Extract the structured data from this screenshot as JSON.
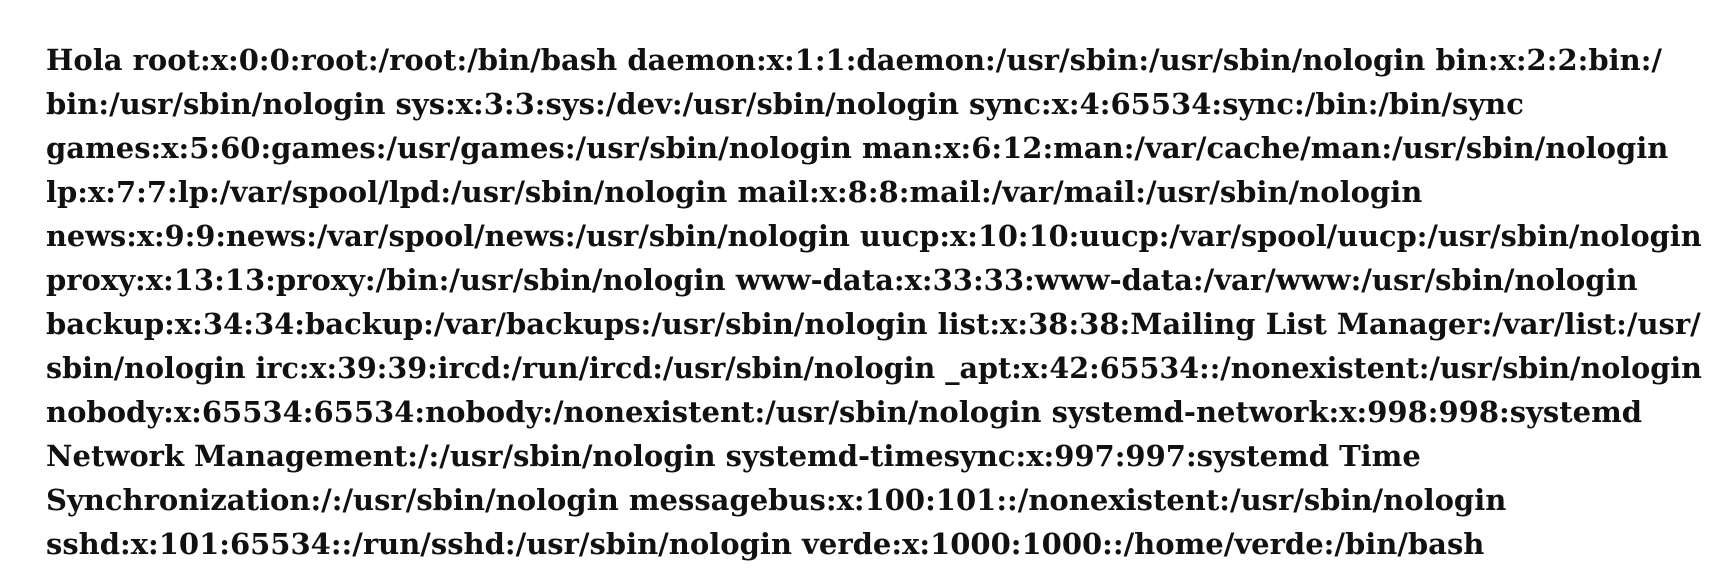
{
  "output": {
    "lines": [
      "Hola root:x:0:0:root:/root:/bin/bash daemon:x:1:1:daemon:/usr/sbin:/usr/sbin/nologin bin:x:2:2:bin:/",
      "bin:/usr/sbin/nologin sys:x:3:3:sys:/dev:/usr/sbin/nologin sync:x:4:65534:sync:/bin:/bin/sync",
      "games:x:5:60:games:/usr/games:/usr/sbin/nologin man:x:6:12:man:/var/cache/man:/usr/sbin/nologin",
      "lp:x:7:7:lp:/var/spool/lpd:/usr/sbin/nologin mail:x:8:8:mail:/var/mail:/usr/sbin/nologin",
      "news:x:9:9:news:/var/spool/news:/usr/sbin/nologin uucp:x:10:10:uucp:/var/spool/uucp:/usr/sbin/nologin",
      "proxy:x:13:13:proxy:/bin:/usr/sbin/nologin www-data:x:33:33:www-data:/var/www:/usr/sbin/nologin",
      "backup:x:34:34:backup:/var/backups:/usr/sbin/nologin list:x:38:38:Mailing List Manager:/var/list:/usr/",
      "sbin/nologin irc:x:39:39:ircd:/run/ircd:/usr/sbin/nologin _apt:x:42:65534::/nonexistent:/usr/sbin/nologin",
      "nobody:x:65534:65534:nobody:/nonexistent:/usr/sbin/nologin systemd-network:x:998:998:systemd",
      "Network Management:/:/usr/sbin/nologin systemd-timesync:x:997:997:systemd Time",
      "Synchronization:/:/usr/sbin/nologin messagebus:x:100:101::/nonexistent:/usr/sbin/nologin",
      "sshd:x:101:65534::/run/sshd:/usr/sbin/nologin verde:x:1000:1000::/home/verde:/bin/bash"
    ]
  }
}
